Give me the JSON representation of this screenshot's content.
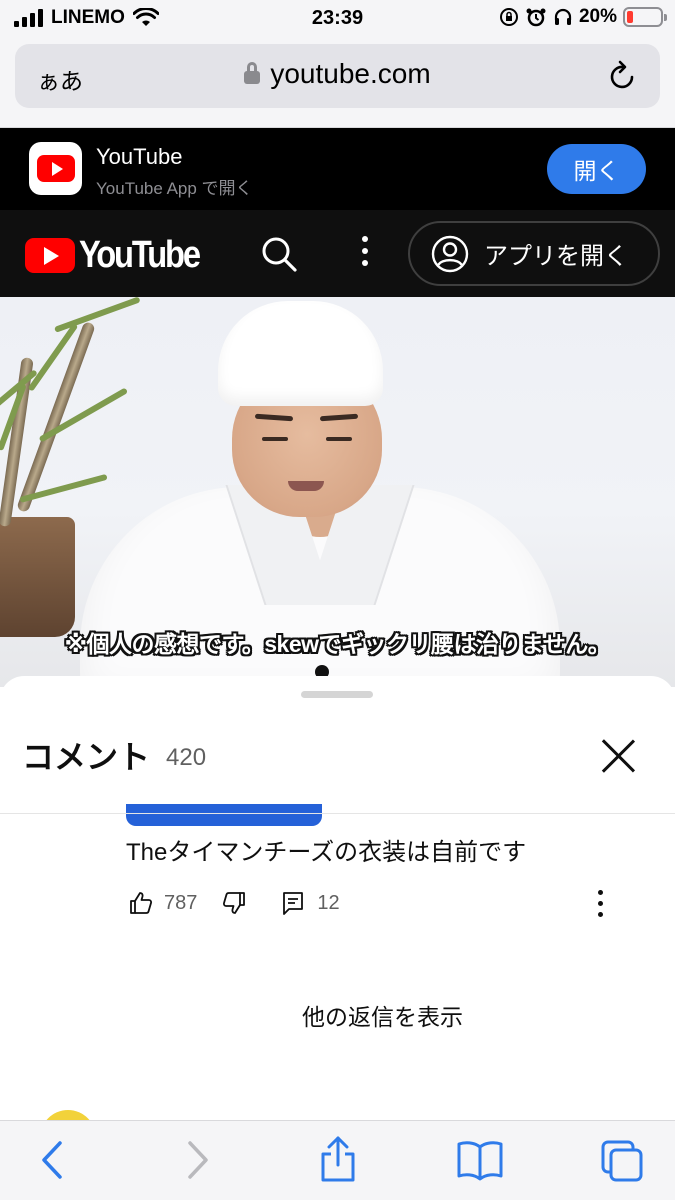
{
  "status_bar": {
    "carrier": "LINEMO",
    "time": "23:39",
    "battery_percent": "20%",
    "battery_level": 0.2,
    "icons": [
      "signal-bars-icon",
      "wifi-icon",
      "orientation-lock-icon",
      "alarm-icon",
      "headphones-icon",
      "battery-icon"
    ]
  },
  "safari": {
    "text_size_button": "ぁあ",
    "url": "youtube.com"
  },
  "app_banner": {
    "app_name": "YouTube",
    "subtitle": "YouTube App で開く",
    "open_button": "開く",
    "button_color": "#2f7bea"
  },
  "yt_header": {
    "wordmark": "YouTube",
    "open_app_button": "アプリを開く",
    "brand_color": "#ff0000"
  },
  "video": {
    "subtitle": "※個人の感想です。skewでギックリ腰は治りません。"
  },
  "comments": {
    "title": "コメント",
    "count": "420",
    "comment_text": "Theタイマンチーズの衣装は自前です",
    "likes": "787",
    "replies": "12",
    "show_more_replies": "他の返信を表示",
    "author_chip_color": "#2561d8"
  }
}
